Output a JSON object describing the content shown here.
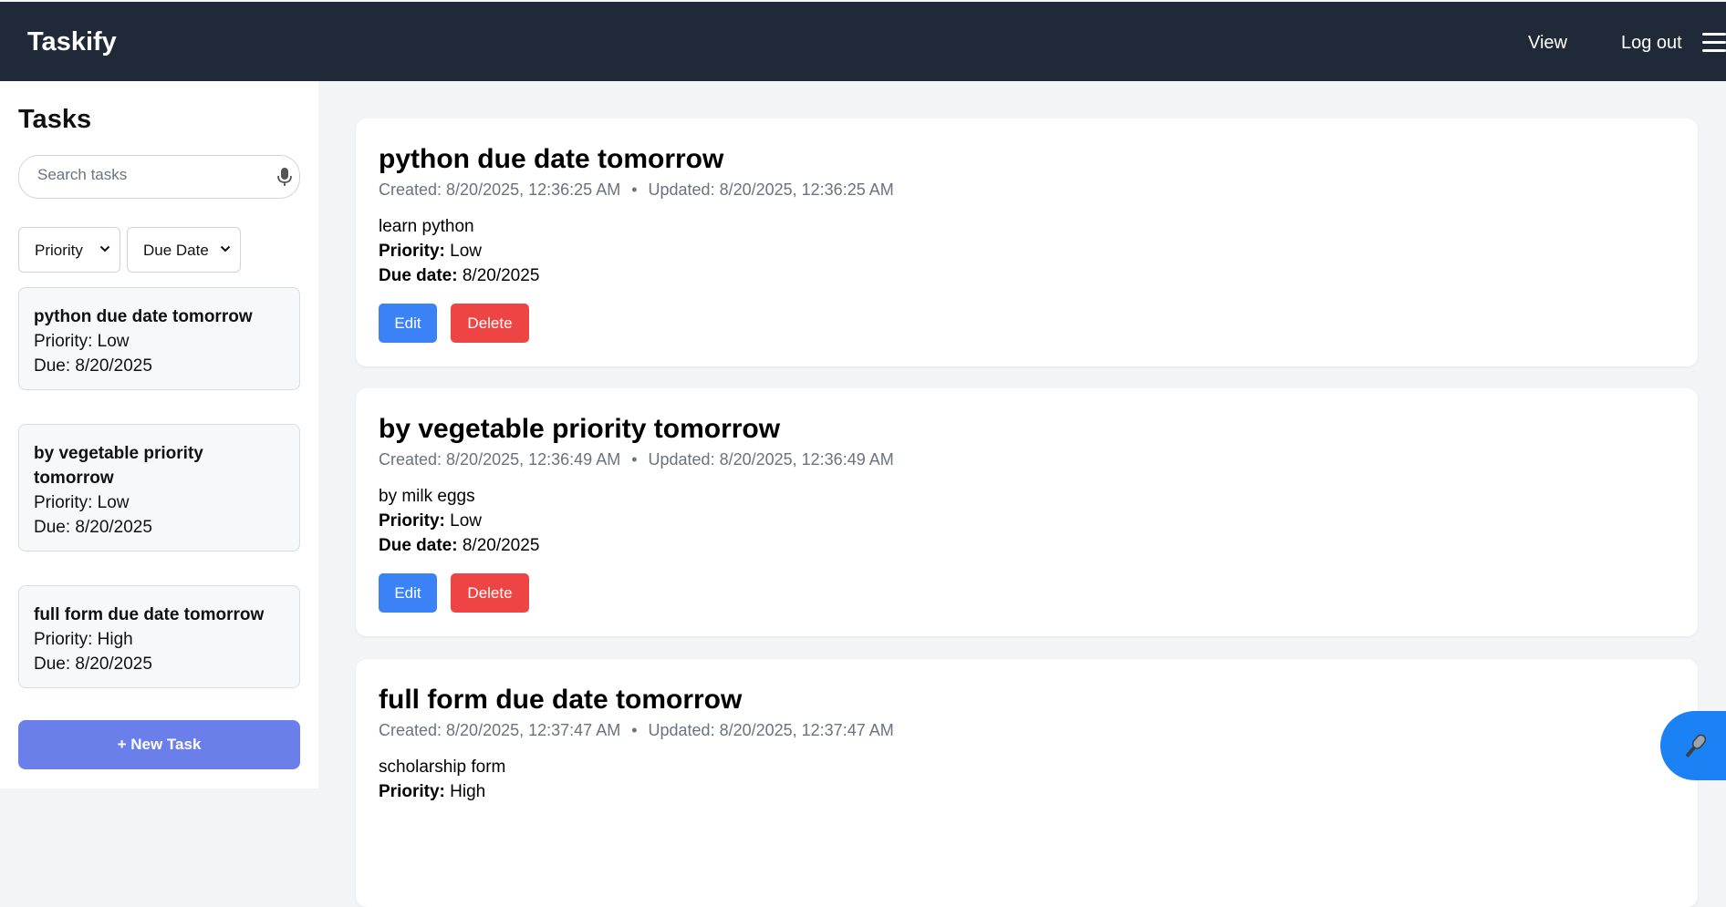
{
  "header": {
    "brand": "Taskify",
    "nav": {
      "view": "View",
      "logout": "Log out"
    },
    "menu_icon": "hamburger-icon"
  },
  "sidebar": {
    "title": "Tasks",
    "search": {
      "placeholder": "Search tasks",
      "value": "",
      "icon": "microphone-icon"
    },
    "filters": {
      "priority": "Priority",
      "due_date": "Due Date"
    },
    "tasks": [
      {
        "title": "python due date tomorrow",
        "priority": "Priority: Low",
        "due": "Due: 8/20/2025"
      },
      {
        "title": "by vegetable priority tomorrow",
        "priority": "Priority: Low",
        "due": "Due: 8/20/2025"
      },
      {
        "title": "full form due date tomorrow",
        "priority": "Priority: High",
        "due": "Due: 8/20/2025"
      }
    ],
    "new_task": "+ New Task"
  },
  "main": {
    "cards": [
      {
        "title": "python due date tomorrow",
        "created": "Created: 8/20/2025, 12:36:25 AM",
        "separator": "•",
        "updated": "Updated: 8/20/2025, 12:36:25 AM",
        "description": "learn python",
        "priority_label": "Priority:",
        "priority": "Low",
        "due_label": "Due date:",
        "due": "8/20/2025",
        "edit": "Edit",
        "delete": "Delete"
      },
      {
        "title": "by vegetable priority tomorrow",
        "created": "Created: 8/20/2025, 12:36:49 AM",
        "separator": "•",
        "updated": "Updated: 8/20/2025, 12:36:49 AM",
        "description": "by milk eggs",
        "priority_label": "Priority:",
        "priority": "Low",
        "due_label": "Due date:",
        "due": "8/20/2025",
        "edit": "Edit",
        "delete": "Delete"
      },
      {
        "title": "full form due date tomorrow",
        "created": "Created: 8/20/2025, 12:37:47 AM",
        "separator": "•",
        "updated": "Updated: 8/20/2025, 12:37:47 AM",
        "description": "scholarship form",
        "priority_label": "Priority:",
        "priority": "High"
      }
    ]
  },
  "fab": {
    "icon": "microphone-icon"
  },
  "colors": {
    "header_bg": "#1f2937",
    "edit": "#3b82f6",
    "delete": "#ef4444",
    "new_task": "#6b7fea",
    "fab": "#1a82f5"
  }
}
